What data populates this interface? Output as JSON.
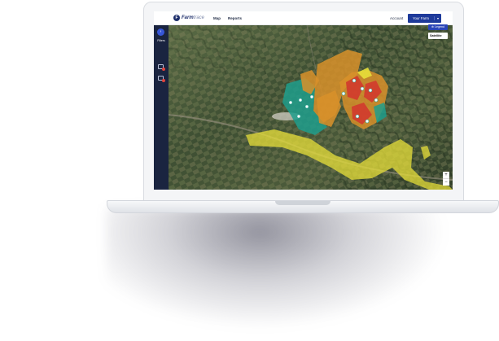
{
  "app": {
    "logo_mark": "F",
    "logo_name_bold": "Farm",
    "logo_name_light": "trace"
  },
  "nav": {
    "items": [
      {
        "label": "Map"
      },
      {
        "label": "Reports"
      }
    ],
    "account_label": "Account",
    "farm_button_label": "Your Farm",
    "farm_button_caret": "▾"
  },
  "sidebar": {
    "toggle_glyph": "›",
    "filters_label": "Filters"
  },
  "map": {
    "legend_label": "⊕ Legend",
    "layer_select_value": "Satellite",
    "zoom_in": "+",
    "zoom_out": "−",
    "colors": {
      "field_orange": "#d8902a",
      "field_teal": "#1e9d8c",
      "field_red": "#d23a2e",
      "corridor_yellow": "#e7df3a",
      "marker": "#ffffff"
    }
  }
}
